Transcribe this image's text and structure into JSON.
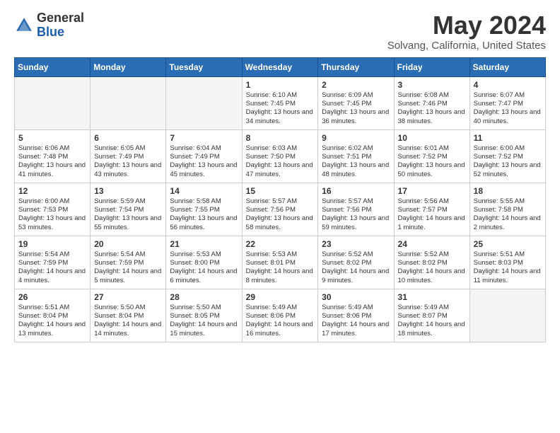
{
  "header": {
    "logo_general": "General",
    "logo_blue": "Blue",
    "month_title": "May 2024",
    "location": "Solvang, California, United States"
  },
  "weekdays": [
    "Sunday",
    "Monday",
    "Tuesday",
    "Wednesday",
    "Thursday",
    "Friday",
    "Saturday"
  ],
  "weeks": [
    [
      {
        "day": "",
        "info": ""
      },
      {
        "day": "",
        "info": ""
      },
      {
        "day": "",
        "info": ""
      },
      {
        "day": "1",
        "info": "Sunrise: 6:10 AM\nSunset: 7:45 PM\nDaylight: 13 hours and 34 minutes."
      },
      {
        "day": "2",
        "info": "Sunrise: 6:09 AM\nSunset: 7:45 PM\nDaylight: 13 hours and 36 minutes."
      },
      {
        "day": "3",
        "info": "Sunrise: 6:08 AM\nSunset: 7:46 PM\nDaylight: 13 hours and 38 minutes."
      },
      {
        "day": "4",
        "info": "Sunrise: 6:07 AM\nSunset: 7:47 PM\nDaylight: 13 hours and 40 minutes."
      }
    ],
    [
      {
        "day": "5",
        "info": "Sunrise: 6:06 AM\nSunset: 7:48 PM\nDaylight: 13 hours and 41 minutes."
      },
      {
        "day": "6",
        "info": "Sunrise: 6:05 AM\nSunset: 7:49 PM\nDaylight: 13 hours and 43 minutes."
      },
      {
        "day": "7",
        "info": "Sunrise: 6:04 AM\nSunset: 7:49 PM\nDaylight: 13 hours and 45 minutes."
      },
      {
        "day": "8",
        "info": "Sunrise: 6:03 AM\nSunset: 7:50 PM\nDaylight: 13 hours and 47 minutes."
      },
      {
        "day": "9",
        "info": "Sunrise: 6:02 AM\nSunset: 7:51 PM\nDaylight: 13 hours and 48 minutes."
      },
      {
        "day": "10",
        "info": "Sunrise: 6:01 AM\nSunset: 7:52 PM\nDaylight: 13 hours and 50 minutes."
      },
      {
        "day": "11",
        "info": "Sunrise: 6:00 AM\nSunset: 7:52 PM\nDaylight: 13 hours and 52 minutes."
      }
    ],
    [
      {
        "day": "12",
        "info": "Sunrise: 6:00 AM\nSunset: 7:53 PM\nDaylight: 13 hours and 53 minutes."
      },
      {
        "day": "13",
        "info": "Sunrise: 5:59 AM\nSunset: 7:54 PM\nDaylight: 13 hours and 55 minutes."
      },
      {
        "day": "14",
        "info": "Sunrise: 5:58 AM\nSunset: 7:55 PM\nDaylight: 13 hours and 56 minutes."
      },
      {
        "day": "15",
        "info": "Sunrise: 5:57 AM\nSunset: 7:56 PM\nDaylight: 13 hours and 58 minutes."
      },
      {
        "day": "16",
        "info": "Sunrise: 5:57 AM\nSunset: 7:56 PM\nDaylight: 13 hours and 59 minutes."
      },
      {
        "day": "17",
        "info": "Sunrise: 5:56 AM\nSunset: 7:57 PM\nDaylight: 14 hours and 1 minute."
      },
      {
        "day": "18",
        "info": "Sunrise: 5:55 AM\nSunset: 7:58 PM\nDaylight: 14 hours and 2 minutes."
      }
    ],
    [
      {
        "day": "19",
        "info": "Sunrise: 5:54 AM\nSunset: 7:59 PM\nDaylight: 14 hours and 4 minutes."
      },
      {
        "day": "20",
        "info": "Sunrise: 5:54 AM\nSunset: 7:59 PM\nDaylight: 14 hours and 5 minutes."
      },
      {
        "day": "21",
        "info": "Sunrise: 5:53 AM\nSunset: 8:00 PM\nDaylight: 14 hours and 6 minutes."
      },
      {
        "day": "22",
        "info": "Sunrise: 5:53 AM\nSunset: 8:01 PM\nDaylight: 14 hours and 8 minutes."
      },
      {
        "day": "23",
        "info": "Sunrise: 5:52 AM\nSunset: 8:02 PM\nDaylight: 14 hours and 9 minutes."
      },
      {
        "day": "24",
        "info": "Sunrise: 5:52 AM\nSunset: 8:02 PM\nDaylight: 14 hours and 10 minutes."
      },
      {
        "day": "25",
        "info": "Sunrise: 5:51 AM\nSunset: 8:03 PM\nDaylight: 14 hours and 11 minutes."
      }
    ],
    [
      {
        "day": "26",
        "info": "Sunrise: 5:51 AM\nSunset: 8:04 PM\nDaylight: 14 hours and 13 minutes."
      },
      {
        "day": "27",
        "info": "Sunrise: 5:50 AM\nSunset: 8:04 PM\nDaylight: 14 hours and 14 minutes."
      },
      {
        "day": "28",
        "info": "Sunrise: 5:50 AM\nSunset: 8:05 PM\nDaylight: 14 hours and 15 minutes."
      },
      {
        "day": "29",
        "info": "Sunrise: 5:49 AM\nSunset: 8:06 PM\nDaylight: 14 hours and 16 minutes."
      },
      {
        "day": "30",
        "info": "Sunrise: 5:49 AM\nSunset: 8:06 PM\nDaylight: 14 hours and 17 minutes."
      },
      {
        "day": "31",
        "info": "Sunrise: 5:49 AM\nSunset: 8:07 PM\nDaylight: 14 hours and 18 minutes."
      },
      {
        "day": "",
        "info": ""
      }
    ]
  ]
}
